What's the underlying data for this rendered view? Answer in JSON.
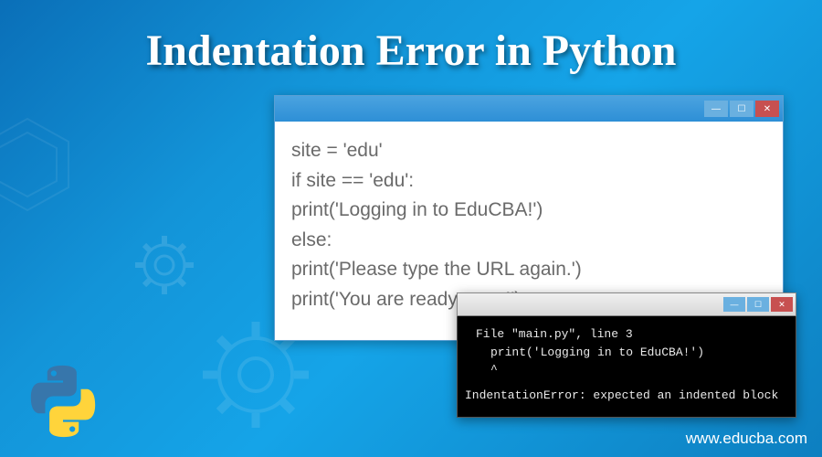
{
  "title": "Indentation Error in Python",
  "editor": {
    "code_lines": [
      "site = 'edu'",
      "if site == 'edu':",
      "print('Logging in to EduCBA!')",
      "else:",
      "print('Please type the URL again.')",
      "print('You are ready to go!')"
    ]
  },
  "terminal": {
    "lines": [
      "File \"main.py\", line 3",
      "print('Logging in to EduCBA!')",
      "^",
      "IndentationError: expected an indented block"
    ]
  },
  "window_controls": {
    "minimize": "—",
    "maximize": "☐",
    "close": "✕"
  },
  "footer": {
    "url": "www.educba.com"
  },
  "logo": {
    "name": "python-logo"
  }
}
